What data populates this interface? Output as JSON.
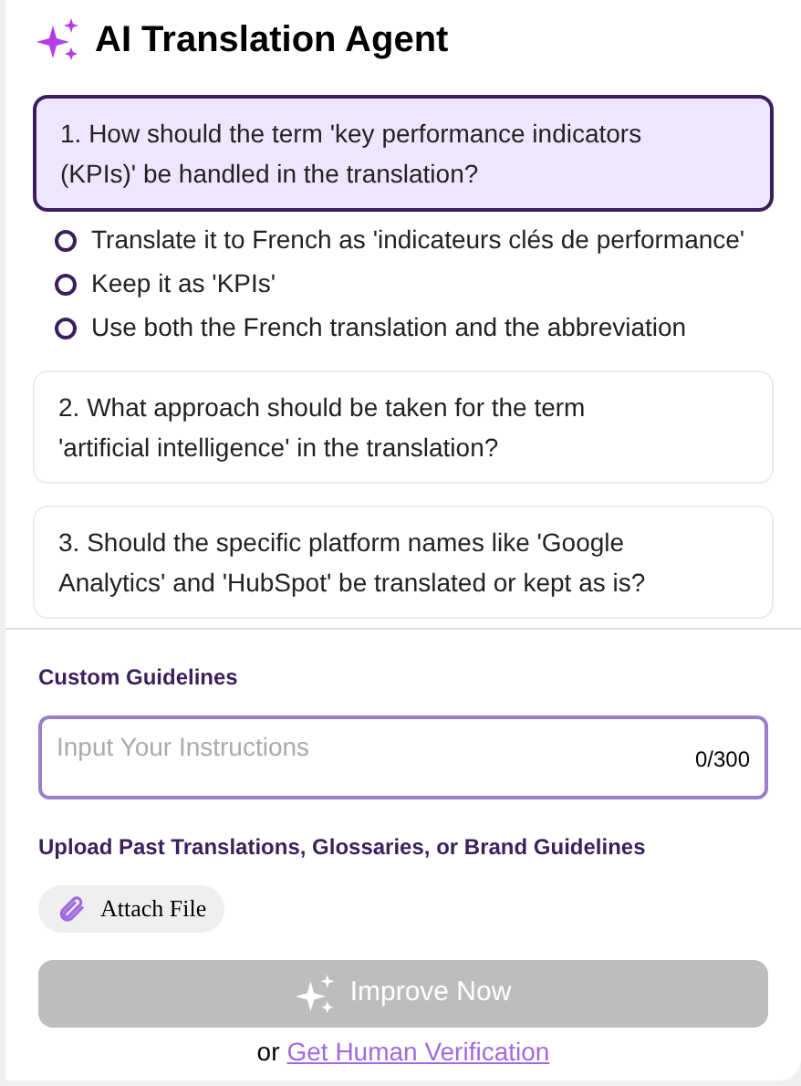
{
  "title": "AI Translation Agent",
  "questions": [
    {
      "text": "1. How should the term 'key performance indicators (KPIs)' be handled in the translation?",
      "expanded": true,
      "options": [
        {
          "label": "Translate it to French as 'indicateurs clés de performance'",
          "selected": false
        },
        {
          "label": "Keep it as 'KPIs'",
          "selected": false
        },
        {
          "label": "Use both the French translation and the abbreviation",
          "selected": false
        }
      ]
    },
    {
      "text": "2. What approach should be taken for the term 'artificial intelligence' in the translation?",
      "expanded": false
    },
    {
      "text": "3. Should the specific platform names like 'Google Analytics' and 'HubSpot' be translated or kept as is?",
      "expanded": false
    }
  ],
  "guidelines": {
    "label": "Custom Guidelines",
    "placeholder": "Input Your Instructions",
    "counter": "0/300"
  },
  "upload": {
    "label": "Upload Past Translations, Glossaries, or Brand Guidelines",
    "button": "Attach File"
  },
  "improve": {
    "label": "Improve Now",
    "disabled": true
  },
  "footer": {
    "prefix": "or",
    "link": "Get Human Verification"
  }
}
